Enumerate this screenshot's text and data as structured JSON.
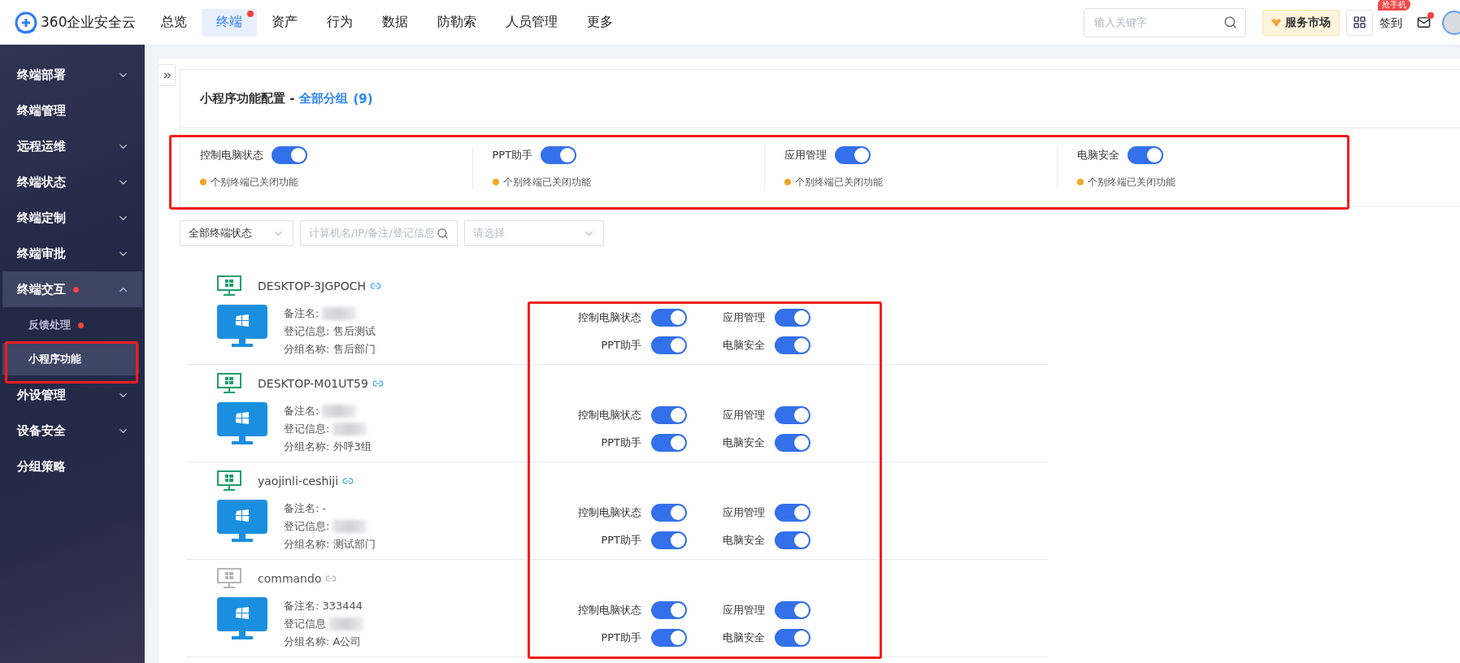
{
  "brand": {
    "name": "360企业安全云"
  },
  "nav": [
    {
      "label": "总览",
      "selected": false,
      "badge": false
    },
    {
      "label": "终端",
      "selected": true,
      "badge": true
    },
    {
      "label": "资产",
      "selected": false,
      "badge": false
    },
    {
      "label": "行为",
      "selected": false,
      "badge": false
    },
    {
      "label": "数据",
      "selected": false,
      "badge": false
    },
    {
      "label": "防勒索",
      "selected": false,
      "badge": false
    },
    {
      "label": "人员管理",
      "selected": false,
      "badge": false
    },
    {
      "label": "更多",
      "selected": false,
      "badge": false
    }
  ],
  "search": {
    "placeholder": "输入关键字"
  },
  "market_button": "服务市场",
  "checkin": {
    "label": "签到",
    "badge": "抢手机"
  },
  "mail": {
    "unread": true
  },
  "sidebar": {
    "items": [
      {
        "kind": "group",
        "label": "终端部署",
        "expanded": false,
        "badge": false
      },
      {
        "kind": "link",
        "label": "终端管理",
        "badge": false
      },
      {
        "kind": "group",
        "label": "远程运维",
        "expanded": false,
        "badge": false
      },
      {
        "kind": "group",
        "label": "终端状态",
        "expanded": false,
        "badge": false
      },
      {
        "kind": "group",
        "label": "终端定制",
        "expanded": false,
        "badge": false
      },
      {
        "kind": "group",
        "label": "终端审批",
        "expanded": false,
        "badge": false
      },
      {
        "kind": "group",
        "label": "终端交互",
        "expanded": true,
        "badge": true,
        "children": [
          {
            "label": "反馈处理",
            "badge": true,
            "selected": false,
            "highlighted": false
          },
          {
            "label": "小程序功能",
            "badge": false,
            "selected": true,
            "highlighted": true
          }
        ]
      },
      {
        "kind": "group",
        "label": "外设管理",
        "expanded": false,
        "badge": false
      },
      {
        "kind": "group",
        "label": "设备安全",
        "expanded": false,
        "badge": false
      },
      {
        "kind": "link",
        "label": "分组策略",
        "badge": false
      }
    ]
  },
  "page": {
    "title": "小程序功能配置 -",
    "group": "全部分组",
    "count": "(9)"
  },
  "features": {
    "highlighted": true,
    "items": [
      {
        "label": "控制电脑状态",
        "on": true,
        "note": "个别终端已关闭功能"
      },
      {
        "label": "PPT助手",
        "on": true,
        "note": "个别终端已关闭功能"
      },
      {
        "label": "应用管理",
        "on": true,
        "note": "个别终端已关闭功能"
      },
      {
        "label": "电脑安全",
        "on": true,
        "note": "个别终端已关闭功能"
      }
    ]
  },
  "filters": {
    "status": "全部终端状态",
    "search_placeholder": "计算机名/IP/备注/登记信息",
    "select_placeholder": "请选择"
  },
  "devices": {
    "toggles_highlighted": true,
    "items": [
      {
        "name": "DESKTOP-3JGPOCH",
        "online": true,
        "remark": "备注名:",
        "remark_redacted": true,
        "info": "登记信息: 售后测试",
        "group": "分组名称: 售后部门",
        "toggles": [
          {
            "label": "控制电脑状态",
            "on": true
          },
          {
            "label": "应用管理",
            "on": true
          },
          {
            "label": "PPT助手",
            "on": true
          },
          {
            "label": "电脑安全",
            "on": true
          }
        ]
      },
      {
        "name": "DESKTOP-M01UT59",
        "online": true,
        "remark": "备注名:",
        "remark_redacted": true,
        "info": "登记信息:",
        "info_redacted": true,
        "group": "分组名称: 外呼3组",
        "toggles": [
          {
            "label": "控制电脑状态",
            "on": true
          },
          {
            "label": "应用管理",
            "on": true
          },
          {
            "label": "PPT助手",
            "on": true
          },
          {
            "label": "电脑安全",
            "on": true
          }
        ]
      },
      {
        "name": "yaojinli-ceshiji",
        "online": true,
        "remark": "备注名: -",
        "info": "登记信息:",
        "info_redacted": true,
        "group": "分组名称: 测试部门",
        "toggles": [
          {
            "label": "控制电脑状态",
            "on": true
          },
          {
            "label": "应用管理",
            "on": true
          },
          {
            "label": "PPT助手",
            "on": true
          },
          {
            "label": "电脑安全",
            "on": true
          }
        ]
      },
      {
        "name": "commando",
        "online": false,
        "remark": "备注名: 333444",
        "info": "登记信息",
        "info_redacted": true,
        "group": "分组名称: A公司",
        "toggles": [
          {
            "label": "控制电脑状态",
            "on": true
          },
          {
            "label": "应用管理",
            "on": true
          },
          {
            "label": "PPT助手",
            "on": true
          },
          {
            "label": "电脑安全",
            "on": true
          }
        ]
      }
    ]
  }
}
